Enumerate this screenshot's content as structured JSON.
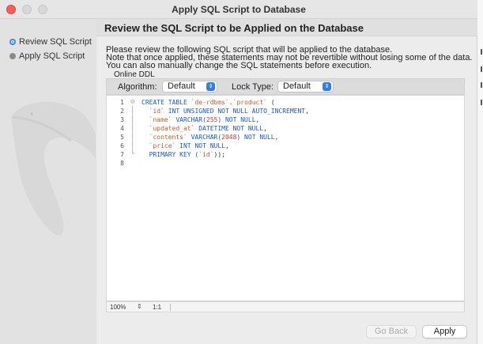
{
  "window": {
    "title": "Apply SQL Script to Database"
  },
  "sidebar": {
    "items": [
      {
        "label": "Review SQL Script",
        "state": "current",
        "icon": "current-step-icon"
      },
      {
        "label": "Apply SQL Script",
        "state": "pending",
        "icon": "pending-step-icon"
      }
    ]
  },
  "main": {
    "heading": "Review the SQL Script to be Applied on the Database",
    "description": [
      "Please review the following SQL script that will be applied to the database.",
      "Note that once applied, these statements may not be revertible without losing some of the data.",
      "You can also manually change the SQL statements before execution."
    ],
    "online_ddl_label": "Online DDL",
    "algorithm": {
      "label": "Algorithm:",
      "value": "Default"
    },
    "lock_type": {
      "label": "Lock Type:",
      "value": "Default"
    }
  },
  "editor": {
    "lines": [
      {
        "n": "1",
        "tokens": [
          {
            "t": "CREATE TABLE ",
            "c": "kw"
          },
          {
            "t": "`de-rdbms`",
            "c": "ident"
          },
          {
            "t": ".",
            "c": "punct"
          },
          {
            "t": "`product`",
            "c": "ident"
          },
          {
            "t": " (",
            "c": "punct"
          }
        ]
      },
      {
        "n": "2",
        "tokens": [
          {
            "t": "  `id`",
            "c": "ident"
          },
          {
            "t": " INT UNSIGNED NOT NULL AUTO_INCREMENT",
            "c": "kw"
          },
          {
            "t": ",",
            "c": "punct"
          }
        ]
      },
      {
        "n": "3",
        "tokens": [
          {
            "t": "  `name`",
            "c": "ident"
          },
          {
            "t": " VARCHAR(",
            "c": "kw"
          },
          {
            "t": "255",
            "c": "num"
          },
          {
            "t": ") NOT NULL",
            "c": "kw"
          },
          {
            "t": ",",
            "c": "punct"
          }
        ]
      },
      {
        "n": "4",
        "tokens": [
          {
            "t": "  `updated_at`",
            "c": "ident"
          },
          {
            "t": " DATETIME NOT NULL",
            "c": "kw"
          },
          {
            "t": ",",
            "c": "punct"
          }
        ]
      },
      {
        "n": "5",
        "tokens": [
          {
            "t": "  `contents`",
            "c": "ident"
          },
          {
            "t": " VARCHAR(",
            "c": "kw"
          },
          {
            "t": "2048",
            "c": "num"
          },
          {
            "t": ") NOT NULL",
            "c": "kw"
          },
          {
            "t": ",",
            "c": "punct"
          }
        ]
      },
      {
        "n": "6",
        "tokens": [
          {
            "t": "  `price`",
            "c": "ident"
          },
          {
            "t": " INT NOT NULL",
            "c": "kw"
          },
          {
            "t": ",",
            "c": "punct"
          }
        ]
      },
      {
        "n": "7",
        "tokens": [
          {
            "t": "  PRIMARY KEY (",
            "c": "kw"
          },
          {
            "t": "`id`",
            "c": "ident"
          },
          {
            "t": "));",
            "c": "punct"
          }
        ]
      },
      {
        "n": "8",
        "tokens": []
      }
    ]
  },
  "statusbar": {
    "zoom": "100%",
    "position": "1:1"
  },
  "buttons": {
    "back": "Go Back",
    "apply": "Apply"
  },
  "colors": {
    "accent": "#2f7fe9",
    "keyword": "#1a56c9",
    "identifier": "#c45a2e",
    "number": "#d0342c",
    "close": "#fe5f57"
  }
}
